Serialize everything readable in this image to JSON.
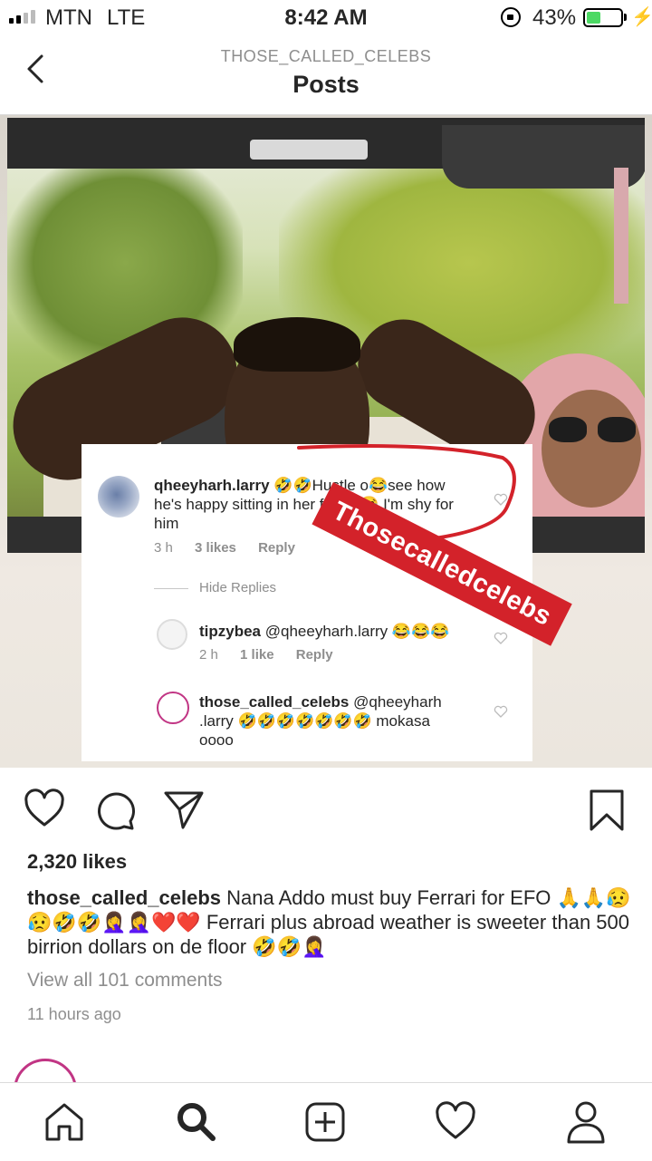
{
  "status_bar": {
    "carrier": "MTN",
    "network": "LTE",
    "time": "8:42 AM",
    "battery_percent": "43%",
    "battery_level": 0.43,
    "icons": [
      "signal-icon",
      "orientation-lock-icon",
      "battery-icon",
      "charging-bolt-icon"
    ]
  },
  "header": {
    "username": "THOSE_CALLED_CELEBS",
    "title": "Posts",
    "back_icon": "chevron-left-icon"
  },
  "post_image": {
    "watermark": "Thosecalledcelebs",
    "comments": [
      {
        "username": "qheeyharh.larry",
        "text": "🤣🤣Hustle o😂see how he's happy sitting in her ferrari😂 I'm shy for him",
        "text_line1": "🤣🤣Hustle o😂see how",
        "text_line2": "he's happy sitting in her ferrari😂 I'm shy for",
        "text_line3": "him",
        "time": "3 h",
        "likes": "3 likes",
        "reply": "Reply"
      },
      {
        "username": "tipzybea",
        "text": "@qheeyharh.larry 😂😂😂",
        "time": "2 h",
        "likes": "1 like",
        "reply": "Reply"
      },
      {
        "username": "those_called_celebs",
        "text_line1": "@qheeyharh",
        "text_line2": ".larry 🤣🤣🤣🤣🤣🤣🤣 mokasa",
        "text_line3": "oooo"
      }
    ],
    "hide_replies": "Hide Replies"
  },
  "actions": {
    "icons": [
      "heart-icon",
      "comment-icon",
      "share-icon",
      "bookmark-icon"
    ]
  },
  "likes": "2,320 likes",
  "caption": {
    "username": "those_called_celebs",
    "text": "Nana Addo must buy Ferrari for EFO 🙏🙏😥😥🤣🤣🤦‍♀️🤦‍♀️❤️❤️ Ferrari plus abroad weather is sweeter than 500 birrion dollars on de floor 🤣🤣🤦‍♀️"
  },
  "view_all_comments": "View all 101 comments",
  "timestamp": "11 hours ago",
  "tab_bar": {
    "icons": [
      "home-icon",
      "search-icon",
      "add-post-icon",
      "activity-heart-icon",
      "profile-icon"
    ]
  },
  "colors": {
    "watermark_red": "#d3222a",
    "annotation_red": "#d3222a",
    "battery_green": "#4cd964",
    "muted_text": "#8e8e8e"
  }
}
